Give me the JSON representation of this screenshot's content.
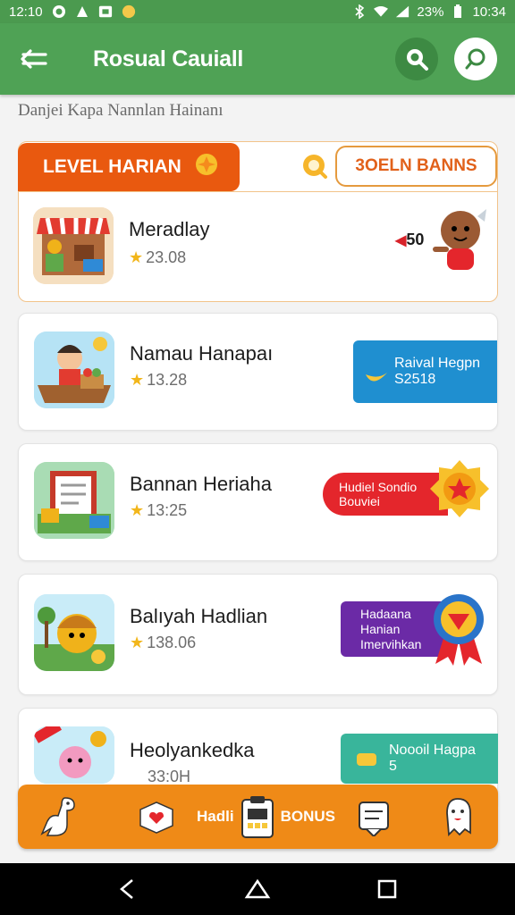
{
  "status_bar": {
    "time_left": "12:10",
    "battery": "23%",
    "time_right": "10:34"
  },
  "appbar": {
    "title": "Rosual Cauiall",
    "back_icon": "arrow-left-icon",
    "search_icon": "search-icon",
    "chat_icon": "chat-search-icon"
  },
  "subtitle": "Danjei Kapa Nannlan Hainanı",
  "level_section": {
    "tab_label": "LEVEL HARIAN",
    "bonus_button": "3OELN BANNS"
  },
  "items": [
    {
      "name": "Meradlay",
      "score": "23.08",
      "badge_text": "50"
    },
    {
      "name": "Namau Hanapaı",
      "score": "13.28",
      "badge_line1": "Raival Hegpn",
      "badge_line2": "S2518"
    },
    {
      "name": "Bannan Heriaha",
      "score": "13:25",
      "badge_line1": "Hudiel Sondio",
      "badge_line2": "Bouviei"
    },
    {
      "name": "Balıyah Hadlian",
      "score": "138.06",
      "badge_line1": "Hadaana",
      "badge_line2": "Hanian",
      "badge_line3": "Imervihkan"
    },
    {
      "name": "Heolyankedka",
      "score": "33:0H",
      "badge_line1": "Noooil Hagpa",
      "badge_line2": "5"
    }
  ],
  "bottom_nav": {
    "hadli_label": "Hadli",
    "bonus_label": "BONUS"
  },
  "colors": {
    "green": "#4fa255",
    "orange": "#ef8a17",
    "red_orange": "#e9590f",
    "blue_badge": "#1f8fd0",
    "red_badge": "#e4262c",
    "purple_badge": "#6b2aa6",
    "teal_badge": "#39b59b"
  }
}
